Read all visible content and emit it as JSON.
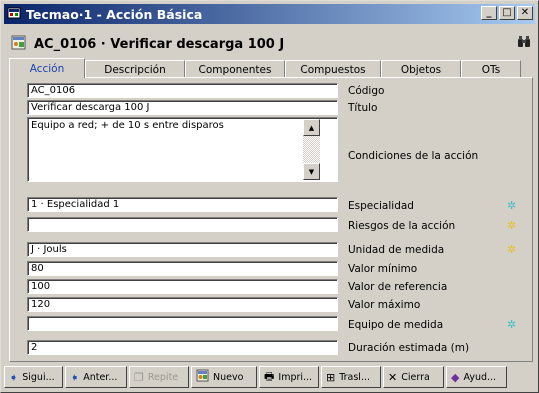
{
  "window": {
    "title": "Tecmao·1 - Acción Básica",
    "minimize": "_",
    "maximize": "□",
    "close": "✕"
  },
  "header": {
    "title": "AC_0106 · Verificar descarga 100 J"
  },
  "tabs": [
    {
      "label": "Acción"
    },
    {
      "label": "Descripción"
    },
    {
      "label": "Componentes"
    },
    {
      "label": "Compuestos"
    },
    {
      "label": "Objetos"
    },
    {
      "label": "OTs"
    }
  ],
  "fields": {
    "codigo": {
      "value": "AC_0106",
      "label": "Código"
    },
    "titulo": {
      "value": "Verificar descarga 100 J",
      "label": "Título"
    },
    "condiciones": {
      "value": "Equipo a red; + de 10 s entre disparos",
      "label": "Condiciones de la acción"
    },
    "especialidad": {
      "value": "1 · Especialidad 1",
      "label": "Especialidad"
    },
    "riesgos": {
      "value": "",
      "label": "Riesgos de la acción"
    },
    "unidad": {
      "value": "J · Jouls",
      "label": "Unidad de medida"
    },
    "minimo": {
      "value": "80",
      "label": "Valor mínimo"
    },
    "referencia": {
      "value": "100",
      "label": "Valor de referencia"
    },
    "maximo": {
      "value": "120",
      "label": "Valor máximo"
    },
    "equipo": {
      "value": "",
      "label": "Equipo de medida"
    },
    "duracion": {
      "value": "2",
      "label": "Duración estimada (m)"
    }
  },
  "toolbar": {
    "siguiente": "Sigui...",
    "anterior": "Anter...",
    "repite": "Repite",
    "nuevo": "Nuevo",
    "imprime": "Impri...",
    "traslada": "Trasl...",
    "cierra": "Cierra",
    "ayuda": "Ayud..."
  },
  "colors": {
    "titlebar_start": "#0a246a",
    "titlebar_end": "#a6caf0",
    "active_tab_text": "#1a3fb0",
    "star_cyan": "#3fc0c8",
    "star_yellow": "#e8c020"
  }
}
